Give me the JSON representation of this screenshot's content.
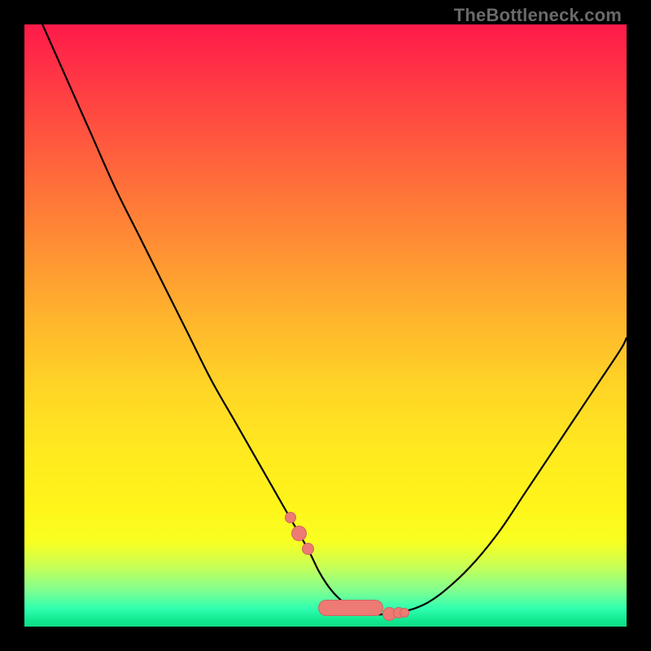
{
  "attribution": "TheBottleneck.com",
  "chart_data": {
    "type": "line",
    "title": "",
    "xlabel": "",
    "ylabel": "",
    "xlim": [
      0,
      100
    ],
    "ylim": [
      0,
      100
    ],
    "grid": false,
    "legend": false,
    "series": [
      {
        "name": "curve",
        "x": [
          3,
          7,
          11,
          15,
          19,
          23,
          27,
          31,
          35,
          39,
          43,
          47,
          49,
          51,
          53,
          55,
          57,
          59,
          63,
          67,
          71,
          75,
          79,
          83,
          87,
          91,
          95,
          99,
          100
        ],
        "y": [
          100,
          91,
          82,
          73,
          65,
          57,
          49,
          41,
          34,
          27,
          20,
          13,
          9,
          6,
          4,
          2.5,
          2,
          2,
          2.5,
          4,
          7,
          11,
          16,
          22,
          28,
          34,
          40,
          46,
          48
        ]
      }
    ],
    "markers": {
      "color": "#ed7a73",
      "pill_region_x": [
        49,
        59
      ],
      "circles": [
        {
          "x": 44,
          "d": 12
        },
        {
          "x": 45.5,
          "d": 17
        },
        {
          "x": 47,
          "d": 13
        },
        {
          "x": 60.5,
          "d": 15
        },
        {
          "x": 62,
          "d": 12
        },
        {
          "x": 63,
          "d": 10
        }
      ]
    },
    "gradient_stops": [
      {
        "pos": 0,
        "color": "#ff1a4a"
      },
      {
        "pos": 50,
        "color": "#ffb82c"
      },
      {
        "pos": 86,
        "color": "#f8ff22"
      },
      {
        "pos": 100,
        "color": "#10dd85"
      }
    ]
  }
}
